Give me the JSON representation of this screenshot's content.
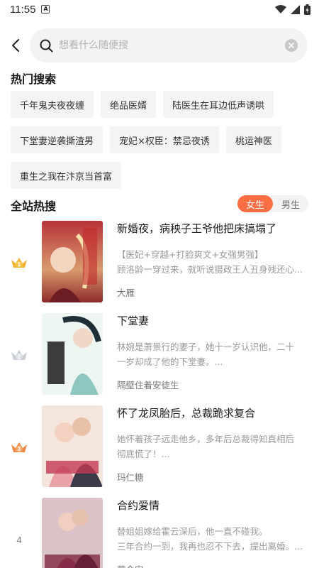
{
  "status_bar": {
    "time": "11:55",
    "notification_letter": "A"
  },
  "search": {
    "placeholder": "想看什么随便搜",
    "value": ""
  },
  "hot_search": {
    "title": "热门搜索",
    "chips": [
      "千年鬼夫夜夜缠",
      "绝品医婿",
      "陆医生在耳边低声诱哄",
      "下堂妻逆袭撕渣男",
      "宠妃×权臣：禁忌夜诱",
      "桃运神医",
      "重生之我在汴京当首富"
    ]
  },
  "site_hot": {
    "title": "全站热搜",
    "gender": {
      "female": "女生",
      "male": "男生",
      "selected": "female"
    },
    "books": [
      {
        "rank": "1",
        "title": "新婚夜，病秧子王爷他把床搞塌了",
        "desc_line1": "【医妃+穿越+打脸爽文+女强男强】",
        "desc_line2": "顾洛龄一穿过来，就听说摄政王人丑身残还心...",
        "author": "大雁"
      },
      {
        "rank": "2",
        "title": "下堂妻",
        "desc_line1": "林婉是萧景行的妻子，她十一岁认识他，二十",
        "desc_line2": "一岁却成了他的下堂妻。...",
        "author": "隔壁住着安徒生"
      },
      {
        "rank": "3",
        "title": "怀了龙凤胎后，总裁跪求复合",
        "desc_line1": "她怀着孩子远走他乡，多年后总裁得知真相后",
        "desc_line2": "彻底慌了！...",
        "author": "玛仁糖"
      },
      {
        "rank": "4",
        "title": "合约爱情",
        "desc_line1": "替姐姐嫁给霍云深后，他一直不碰我。",
        "desc_line2": "三年合约一到，我再也忍不下去，提出离婚。...",
        "author": "茜今安"
      }
    ]
  },
  "colors": {
    "accent": "#fd6e45",
    "gold": "#f2b233",
    "silver": "#c9cdd6",
    "bronze": "#ee8a45"
  }
}
